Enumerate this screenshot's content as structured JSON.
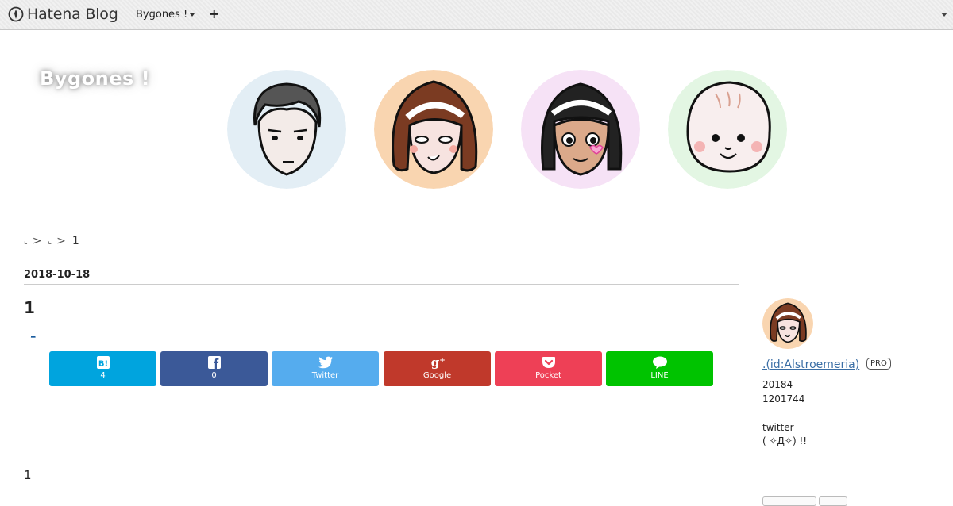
{
  "topbar": {
    "brand": "Hatena Blog",
    "blog_name": "Bygones !",
    "add_symbol": "+"
  },
  "header": {
    "site_title": "Bygones !"
  },
  "breadcrumb": {
    "crumb1": "⌞",
    "crumb2": "⌞",
    "separator": ">",
    "current": "1"
  },
  "entry": {
    "date": "2018-10-18",
    "title": "1",
    "link_text": "_",
    "body_text": "1"
  },
  "share_buttons": [
    {
      "label": "4",
      "icon": "hatena-bookmark-icon",
      "color": "#00a4de"
    },
    {
      "label": "0",
      "icon": "facebook-icon",
      "color": "#3b5998"
    },
    {
      "label": "Twitter",
      "icon": "twitter-icon",
      "color": "#55acee"
    },
    {
      "label": "Google",
      "icon": "google-plus-icon",
      "color": "#c0392b"
    },
    {
      "label": "Pocket",
      "icon": "pocket-icon",
      "color": "#ee4056"
    },
    {
      "label": "LINE",
      "icon": "line-icon",
      "color": "#00c300"
    }
  ],
  "sidebar": {
    "profile_name": ".(id:Alstroemeria)",
    "pro_badge": "PRO",
    "line1": "20184",
    "line2": "1201744",
    "line3": "twitter",
    "line4": "( ✧Д✧) !!"
  },
  "avatars": [
    {
      "name": "man-avatar",
      "bg": "#e3eef5"
    },
    {
      "name": "woman-avatar",
      "bg": "#f9d5b0"
    },
    {
      "name": "girl-avatar",
      "bg": "#f6e2f6"
    },
    {
      "name": "baby-avatar",
      "bg": "#e3f6e3"
    }
  ]
}
